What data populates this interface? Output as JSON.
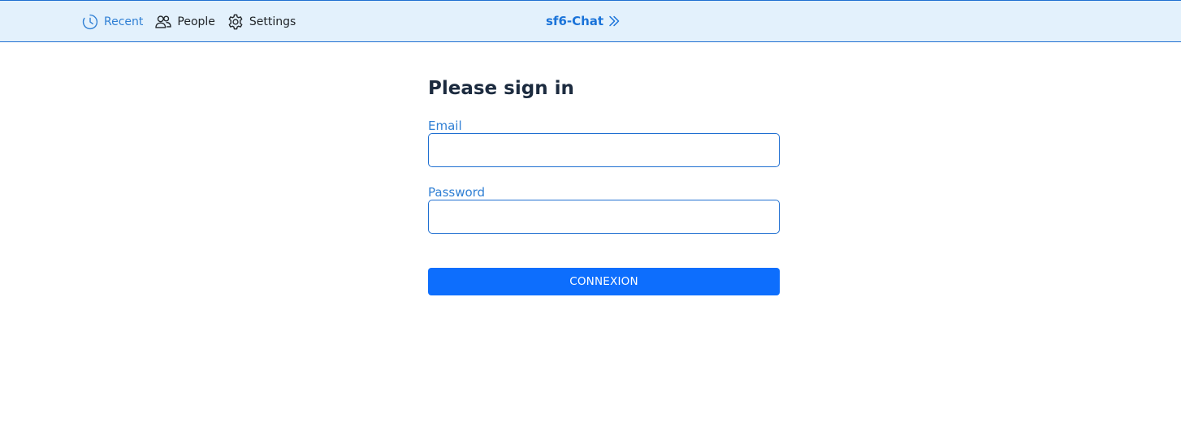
{
  "header": {
    "nav": [
      {
        "label": "Recent",
        "icon": "clock-icon",
        "active": true
      },
      {
        "label": "People",
        "icon": "people-icon",
        "active": false
      },
      {
        "label": "Settings",
        "icon": "gear-icon",
        "active": false
      }
    ],
    "brand": {
      "label": "sf6-Chat",
      "icon": "double-chevron-right-icon"
    }
  },
  "login": {
    "title": "Please sign in",
    "email_label": "Email",
    "email_value": "",
    "password_label": "Password",
    "password_value": "",
    "submit_label": "CONNEXION"
  },
  "colors": {
    "header_bg": "#e3f1fc",
    "header_border": "#1f6fd1",
    "accent": "#2f7fd4",
    "brand": "#1a73d9",
    "button": "#0d6efd",
    "title": "#1c2b3f"
  }
}
